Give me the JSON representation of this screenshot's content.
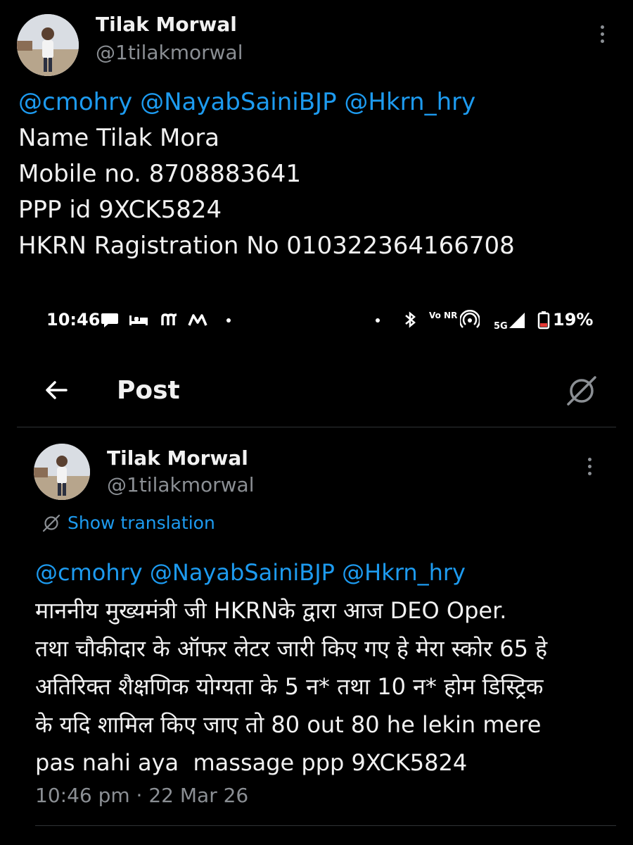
{
  "outer_tweet": {
    "author_name": "Tilak Morwal",
    "handle": "@1tilakmorwal",
    "mentions": "@cmohry @NayabSainiBJP @Hkrn_hry",
    "lines": [
      "Name Tilak Mora",
      "Mobile no. 8708883641",
      "PPP id 9XCK5824",
      "HKRN Ragistration No 010322364166708"
    ]
  },
  "status_bar": {
    "time": "10:46",
    "network": "5G",
    "volte": "Vo NR",
    "battery": "19%"
  },
  "header": {
    "title": "Post"
  },
  "inner_tweet": {
    "author_name": "Tilak Morwal",
    "handle": "@1tilakmorwal",
    "show_translation": "Show translation",
    "mentions": "@cmohry @NayabSainiBJP @Hkrn_hry",
    "lines": [
      "माननीय मुख्यमंत्री जी HKRNके द्वारा आज DEO Oper.",
      "तथा चौकीदार के ऑफर लेटर जारी किए गए हे मेरा स्कोर 65 हे",
      "अतिरिक्त शैक्षणिक योग्यता के 5 न* तथा 10 न* होम डिस्ट्रिक",
      "के यदि शामिल किए जाए तो 80 out 80 he lekin mere",
      "pas nahi aya  massage ppp 9XCK5824"
    ],
    "timestamp": "10:46 pm · 22 Mar 26"
  },
  "colors": {
    "background": "#000000",
    "link": "#1d9bf0",
    "muted": "#8b8f94",
    "divider": "#2f3336"
  },
  "icons": [
    "more-vertical-icon",
    "back-arrow-icon",
    "translate-icon",
    "message-icon",
    "bed-icon",
    "bluetooth-icon",
    "hotspot-icon",
    "signal-icon",
    "battery-icon"
  ]
}
